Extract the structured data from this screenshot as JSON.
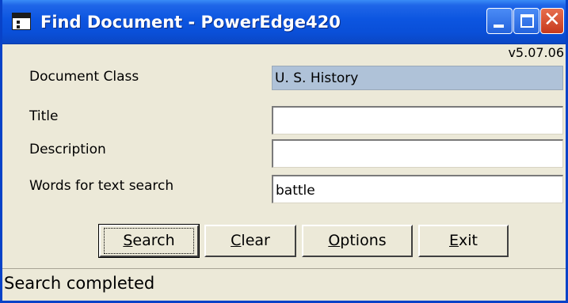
{
  "window": {
    "title": "Find Document - PowerEdge420",
    "version": "v5.07.06"
  },
  "fields": [
    {
      "label": "Document Class",
      "value": "U. S. History",
      "placeholder": ""
    },
    {
      "label": "Title",
      "value": "",
      "placeholder": ""
    },
    {
      "label": "Description",
      "value": "",
      "placeholder": ""
    },
    {
      "label": "Words for text search",
      "value": "battle",
      "placeholder": ""
    }
  ],
  "buttons": {
    "search": {
      "pre": "",
      "key": "S",
      "post": "earch"
    },
    "clear": {
      "pre": "",
      "key": "C",
      "post": "lear"
    },
    "options": {
      "pre": "",
      "key": "O",
      "post": "ptions"
    },
    "exit": {
      "pre": "",
      "key": "E",
      "post": "xit"
    }
  },
  "status": {
    "text": "Search completed"
  },
  "icons": {
    "app": "app-window-icon",
    "minimize": "minimize-icon",
    "maximize": "maximize-icon",
    "close": "close-icon"
  },
  "colors": {
    "titlebar": "#0a4fd8",
    "window_bg": "#ece9d8",
    "readonly_field": "#afc2d8",
    "close_button": "#c6391d"
  }
}
